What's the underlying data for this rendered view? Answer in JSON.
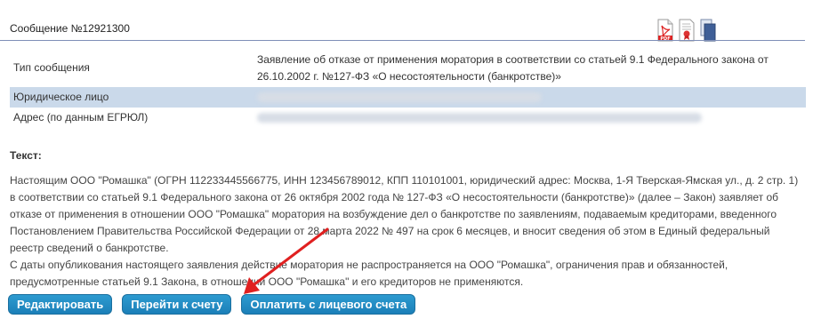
{
  "header": {
    "title": "Сообщение №12921300"
  },
  "icons": [
    "pdf-icon",
    "certificate-icon",
    "copy-icon"
  ],
  "info": {
    "rows": [
      {
        "label": "Тип сообщения",
        "value": "Заявление об отказе от применения моратория в соответствии со статьей 9.1 Федерального закона от 26.10.2002 г. №127-ФЗ «О несостоятельности (банкротстве)»",
        "redacted": false
      },
      {
        "label": "Юридическое лицо",
        "value": "",
        "redacted": true
      },
      {
        "label": "Адрес (по данным ЕГРЮЛ)",
        "value": "",
        "redacted": true
      }
    ]
  },
  "text": {
    "heading": "Текст:",
    "paragraphs": [
      "Настоящим ООО \"Ромашка\" (ОГРН 112233445566775, ИНН 123456789012, КПП 110101001, юридический адрес: Москва, 1-Я Тверская-Ямская ул., д. 2 стр. 1) в соответствии со статьей 9.1 Федерального закона от 26 октября 2002 года № 127-ФЗ «О несостоятельности (банкротстве)» (далее – Закон) заявляет об отказе от применения в отношении ООО \"Ромашка\" моратория на возбуждение дел о банкротстве по заявлениям, подаваемым кредиторами, введенного Постановлением Правительства Российской Федерации от 28 марта 2022 № 497 на срок 6 месяцев, и вносит сведения об этом в Единый федеральный реестр сведений о банкротстве.",
      "С даты опубликования настоящего заявления действие моратория не распространяется на ООО \"Ромашка\", ограничения прав и обязанностей, предусмотренные статьей 9.1 Закона, в отношении ООО \"Ромашка\" и его кредиторов не применяются."
    ]
  },
  "buttons": {
    "edit": "Редактировать",
    "go_to_invoice": "Перейти к счету",
    "pay_from_account": "Оплатить с лицевого счета"
  },
  "colors": {
    "button_bg": "#1b7fb8",
    "highlight_row": "#cad9ea",
    "arrow": "#e02020"
  }
}
